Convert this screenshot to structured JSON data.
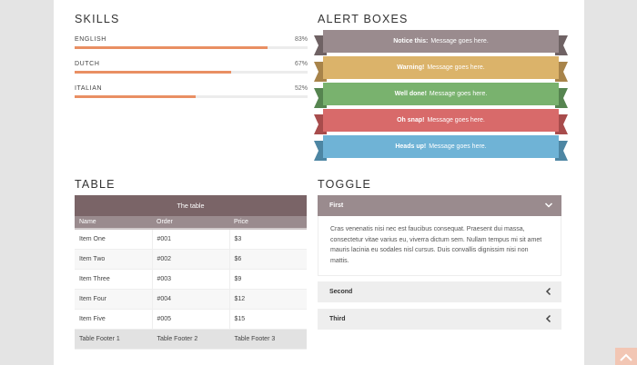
{
  "skills": {
    "title": "SKILLS",
    "items": [
      {
        "name": "ENGLISH",
        "percent_label": "83%",
        "percent": 83
      },
      {
        "name": "DUTCH",
        "percent_label": "67%",
        "percent": 67
      },
      {
        "name": "ITALIAN",
        "percent_label": "52%",
        "percent": 52
      }
    ]
  },
  "alerts": {
    "title": "ALERT BOXES",
    "items": [
      {
        "strong": "Notice this:",
        "text": "Message goes here.",
        "color": "#9a8b8e",
        "tail": "#6f6264"
      },
      {
        "strong": "Warning!",
        "text": "Message goes here.",
        "color": "#dbb36a",
        "tail": "#a8844a"
      },
      {
        "strong": "Well done!",
        "text": "Message goes here.",
        "color": "#79b26e",
        "tail": "#568550"
      },
      {
        "strong": "Oh snap!",
        "text": "Message goes here.",
        "color": "#d86a6a",
        "tail": "#a84c4c"
      },
      {
        "strong": "Heads up!",
        "text": "Message goes here.",
        "color": "#6fb3d6",
        "tail": "#4d86a3"
      }
    ]
  },
  "table": {
    "title": "TABLE",
    "caption": "The table",
    "headers": [
      "Name",
      "Order",
      "Price"
    ],
    "rows": [
      [
        "Item One",
        "#001",
        "$3"
      ],
      [
        "Item Two",
        "#002",
        "$6"
      ],
      [
        "Item Three",
        "#003",
        "$9"
      ],
      [
        "Item Four",
        "#004",
        "$12"
      ],
      [
        "Item Five",
        "#005",
        "$15"
      ]
    ],
    "footer": [
      "Table Footer 1",
      "Table Footer 2",
      "Table Footer 3"
    ]
  },
  "toggle": {
    "title": "TOGGLE",
    "first": {
      "label": "First",
      "body": "Cras venenatis nisi nec est faucibus consequat. Praesent dui massa, consectetur vitae varius eu, viverra dictum sem. Nullam tempus mi sit amet mauris lacinia eu sodales nisl cursus. Duis convallis dignissim nisi non mattis."
    },
    "second": {
      "label": "Second"
    },
    "third": {
      "label": "Third"
    }
  },
  "icons": {
    "toggle_open": "chevron-down-icon",
    "toggle_closed": "chevron-left-icon",
    "scroll_top": "chevron-up-icon"
  },
  "colors": {
    "skill_bar": "#e98f63",
    "table_caption": "#7a6467",
    "table_head": "#9a8b8e",
    "toggle_active": "#9a8b8e",
    "scroll_top": "#f2c6b4"
  }
}
